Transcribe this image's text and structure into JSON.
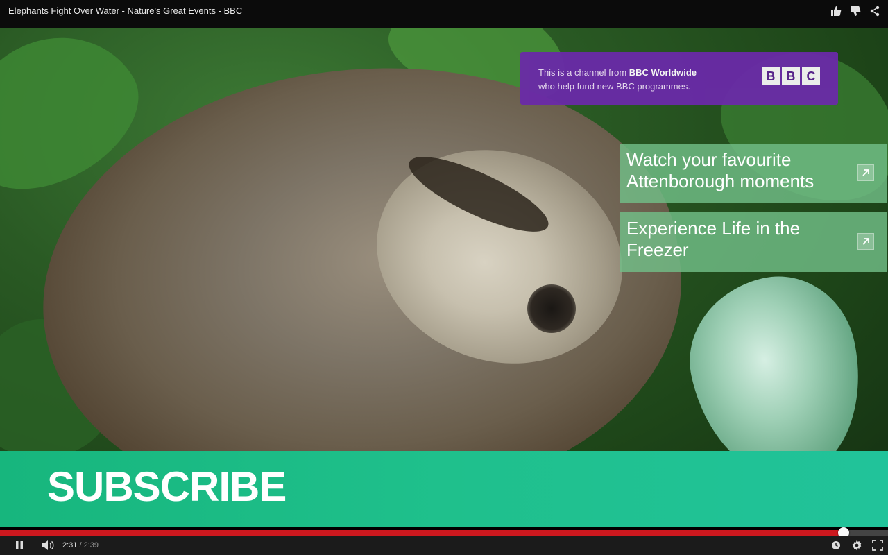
{
  "video": {
    "title": "Elephants Fight Over Water - Nature's Great Events - BBC"
  },
  "top_actions": [
    {
      "name": "like-icon"
    },
    {
      "name": "dislike-icon"
    },
    {
      "name": "share-icon"
    }
  ],
  "bbc_banner": {
    "line1_prefix": "This is a channel from ",
    "line1_bold": "BBC Worldwide",
    "line2": "who help fund new BBC programmes.",
    "logo_letters": [
      "B",
      "B",
      "C"
    ]
  },
  "annotations": [
    {
      "text": "Watch your favourite Attenborough moments"
    },
    {
      "text": "Experience Life in the Freezer"
    }
  ],
  "subscribe": {
    "label": "SUBSCRIBE"
  },
  "player": {
    "current_time": "2:31",
    "duration_text": "/ 2:39",
    "progress_fraction": 0.9497
  },
  "colors": {
    "progress": "#cc181e",
    "subscribe_bar": "#1fc08c",
    "banner": "#6a2aa8",
    "card": "#72be88"
  }
}
